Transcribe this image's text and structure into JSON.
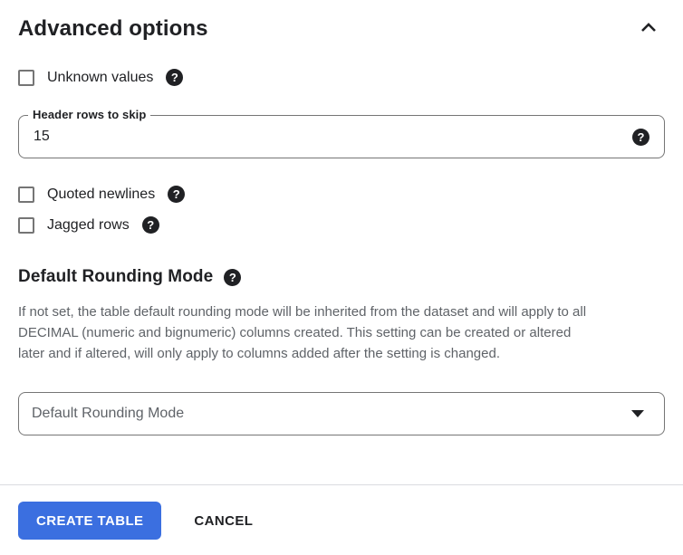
{
  "header": {
    "title": "Advanced options",
    "collapse_icon": "chevron-up"
  },
  "checkboxes": [
    {
      "label": "Unknown values",
      "checked": false,
      "help_icon": "help"
    },
    {
      "label": "Quoted newlines",
      "checked": false,
      "help_icon": "help"
    },
    {
      "label": "Jagged rows",
      "checked": false,
      "help_icon": "help"
    }
  ],
  "fields": {
    "header_rows_to_skip": {
      "label": "Header rows to skip",
      "value": "15",
      "help_icon": "help"
    }
  },
  "rounding": {
    "heading": "Default Rounding Mode",
    "help_icon": "help",
    "description": "If not set, the table default rounding mode will be inherited from the dataset and will apply to all DECIMAL (numeric and bignumeric) columns created. This setting can be created or altered later and if altered, will only apply to columns added after the setting is changed.",
    "description_lines": [
      "If not set, the table default rounding mode will be inherited from the dataset and will apply to all",
      "DECIMAL (numeric and bignumeric) columns created. This setting can be created or altered",
      "later and if altered, will only apply to columns added after the setting is changed."
    ],
    "dropdown_placeholder": "Default Rounding Mode"
  },
  "footer": {
    "create_label": "CREATE TABLE",
    "cancel_label": "CANCEL"
  },
  "icons": {
    "help_glyph": "?"
  },
  "colors": {
    "primary_button": "#3b6fe0",
    "primary_button_text": "#ffffff",
    "text_primary": "#202124",
    "text_secondary": "#5f6368",
    "outline": "#757575",
    "divider": "#dadce0"
  }
}
